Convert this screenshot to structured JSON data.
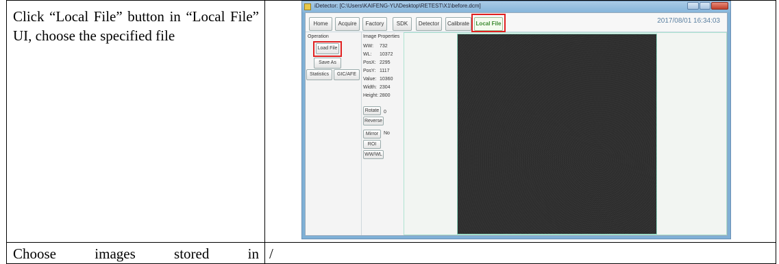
{
  "rows": [
    {
      "step_text": "Click “Local File” button in “Local File” UI, choose the specified file",
      "screenshot": {
        "window_title": "iDetector: [C:\\Users\\KAIFENG-YU\\Desktop\\RETEST\\X1\\before.dcm]",
        "toolbar": {
          "buttons": [
            "Home",
            "Acquire",
            "Factory",
            "SDK",
            "Detector",
            "Calibrate",
            "Local File"
          ],
          "active": "Local File",
          "datetime": "2017/08/01 16:34:03"
        },
        "operation": {
          "header": "Operation",
          "load_file": "Load File",
          "save_as": "Save As",
          "statistics": "Statistics",
          "gic_afe": "GIC/AFE"
        },
        "image_properties": {
          "header": "Image Properties",
          "rows": [
            {
              "key": "WW:",
              "value": "732"
            },
            {
              "key": "WL:",
              "value": "10372"
            },
            {
              "key": "PosX:",
              "value": "2295"
            },
            {
              "key": "PosY:",
              "value": "1117"
            },
            {
              "key": "Value:",
              "value": "10360"
            },
            {
              "key": "Width:",
              "value": "2304"
            },
            {
              "key": "Height:",
              "value": "2800"
            }
          ],
          "rotate_label": "Rotate",
          "rotate_value": "0",
          "reverse_label": "Reverse",
          "mirror_label": "Mirror",
          "mirror_value": "No",
          "roi_label": "ROI",
          "wwwl_label": "WW/WL"
        },
        "highlight_color": "#e02020"
      }
    },
    {
      "step_text_words": [
        "Choose",
        "images",
        "stored",
        "in"
      ],
      "result": "/"
    }
  ]
}
